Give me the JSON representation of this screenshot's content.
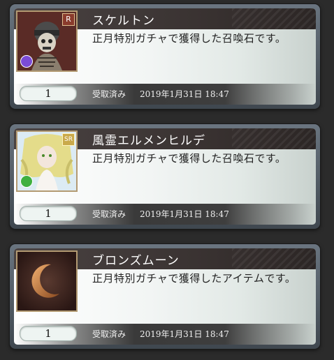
{
  "items": [
    {
      "name": "スケルトン",
      "description": "正月特別ガチャで獲得した召喚石です。",
      "quantity": "1",
      "status": "受取済み",
      "date": "2019年1月31日 18:47",
      "rarity": "R",
      "element_color": "#7b4bd6",
      "thumb_icon": "skeleton-summon-icon"
    },
    {
      "name": "風霊エルメンヒルデ",
      "description": "正月特別ガチャで獲得した召喚石です。",
      "quantity": "1",
      "status": "受取済み",
      "date": "2019年1月31日 18:47",
      "rarity": "SR",
      "element_color": "#3fb03f",
      "thumb_icon": "wind-spirit-summon-icon"
    },
    {
      "name": "ブロンズムーン",
      "description": "正月特別ガチャで獲得したアイテムです。",
      "quantity": "1",
      "status": "受取済み",
      "date": "2019年1月31日 18:47",
      "thumb_icon": "bronze-moon-item-icon"
    }
  ]
}
